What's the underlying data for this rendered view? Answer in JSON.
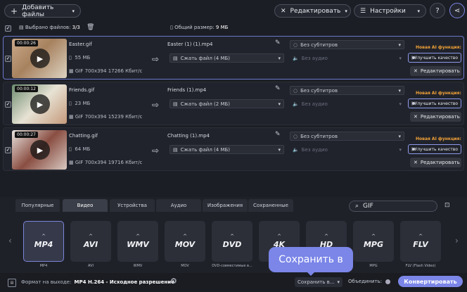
{
  "toolbar": {
    "add_files": "Добавить файлы",
    "edit": "Редактировать",
    "settings": "Настройки",
    "help": "?"
  },
  "subbar": {
    "selected_label": "Выбрано файлов:",
    "selected_count": "3/3",
    "total_size_label": "Общий размер:",
    "total_size": "9 МБ"
  },
  "files": [
    {
      "duration": "00:00:26",
      "name": "Easter.gif",
      "size": "55 МБ",
      "info": "GIF 700x394 17266 Кбит/с",
      "output_name": "Easter (1) (1).mp4",
      "compress": "Сжать файл (4 МБ)",
      "subtitles": "Без субтитров",
      "audio": "Без аудио",
      "new_ai": "Новая AI функция:",
      "enhance": "Улучшить качество",
      "edit": "Редактировать",
      "selected": true
    },
    {
      "duration": "00:00:12",
      "name": "Friends.gif",
      "size": "23 МБ",
      "info": "GIF 700x394 15239 Кбит/с",
      "output_name": "Friends (1).mp4",
      "compress": "Сжать файл (2 МБ)",
      "subtitles": "Без субтитров",
      "audio": "Без аудио",
      "new_ai": "Новая AI функция:",
      "enhance": "Улучшить качество",
      "edit": "Редактировать",
      "selected": false
    },
    {
      "duration": "00:00:27",
      "name": "Chatting.gif",
      "size": "64 МБ",
      "info": "GIF 700x394 19716 Кбит/с",
      "output_name": "Chatting (1).mp4",
      "compress": "Сжать файл (4 МБ)",
      "subtitles": "Без субтитров",
      "audio": "Без аудио",
      "new_ai": "Новая AI функция:",
      "enhance": "Улучшить качество",
      "edit": "Редактировать",
      "selected": false
    }
  ],
  "tabs": [
    "Популярные",
    "Видео",
    "Устройства",
    "Аудио",
    "Изображения",
    "Сохраненные"
  ],
  "active_tab": "Видео",
  "search_value": "GIF",
  "formats": [
    {
      "badge": "MP4",
      "label": "MP4"
    },
    {
      "badge": "AVI",
      "label": "AVI"
    },
    {
      "badge": "WMV",
      "label": "WMV"
    },
    {
      "badge": "MOV",
      "label": "MOV"
    },
    {
      "badge": "DVD",
      "label": "DVD-совместимые в..."
    },
    {
      "badge": "4K",
      "label": ""
    },
    {
      "badge": "HD",
      "label": ""
    },
    {
      "badge": "MPG",
      "label": "MPG"
    },
    {
      "badge": "FLV",
      "label": "FLV (Flash Video)"
    }
  ],
  "bottom": {
    "format_label": "Формат на выходе:",
    "format_value": "MP4 H.264 - Исходное разрешение",
    "save_to": "Сохранить в...",
    "merge": "Объединить:",
    "convert": "Конвертировать"
  },
  "tooltip": "Сохранить в",
  "colors": {
    "accent": "#7b86e8",
    "new_ai": "#f2a238",
    "background": "#1c1e25"
  }
}
